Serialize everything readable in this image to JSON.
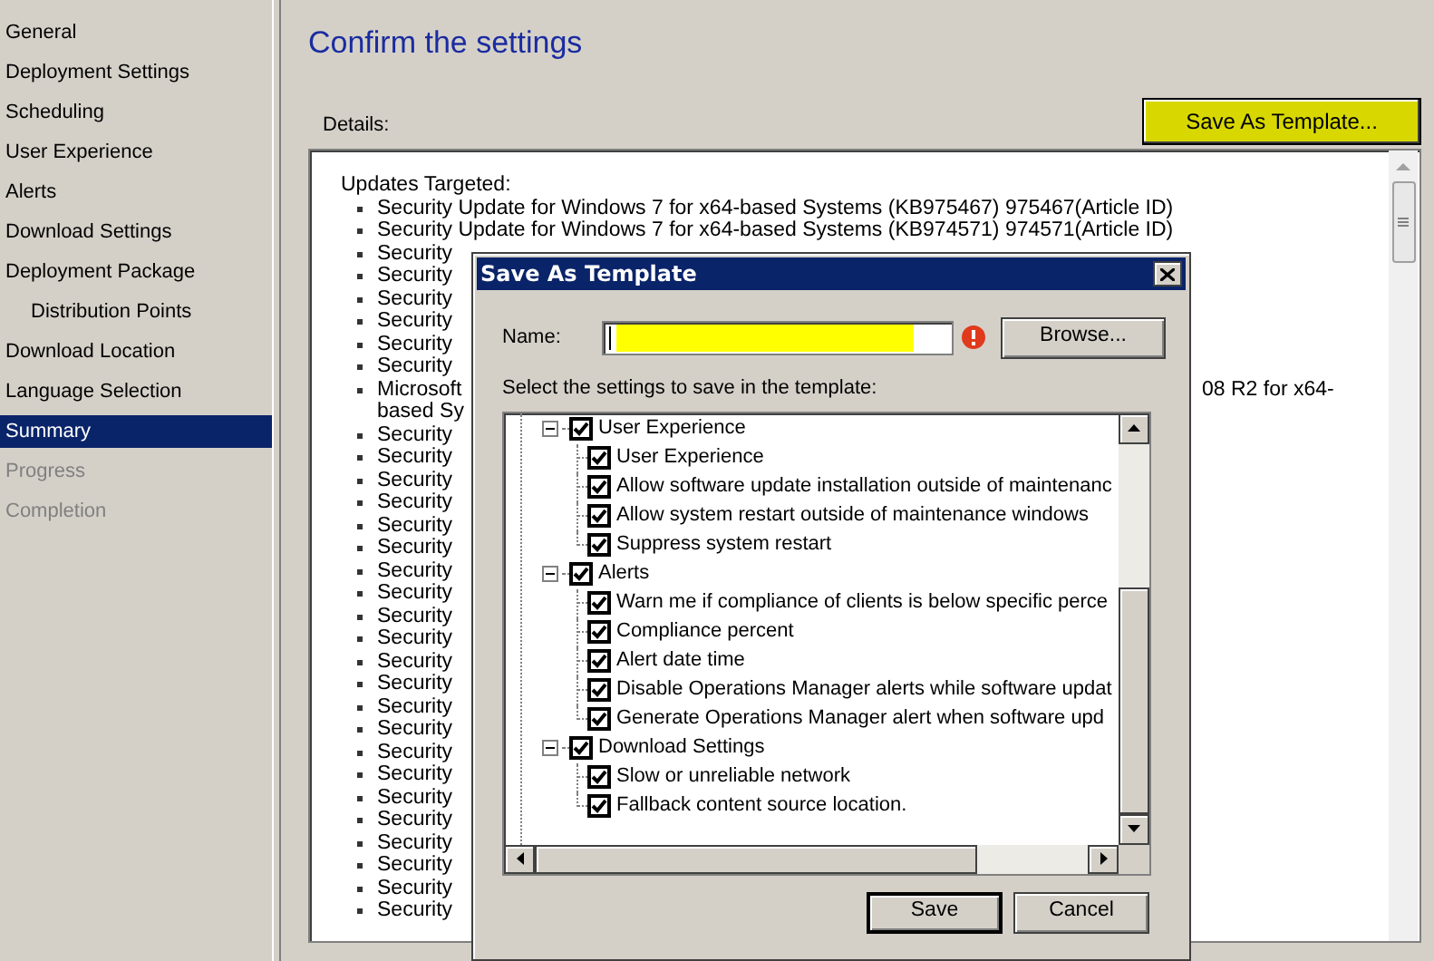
{
  "sidebar": {
    "items": [
      {
        "label": "General",
        "selected": false,
        "disabled": false
      },
      {
        "label": "Deployment Settings",
        "selected": false,
        "disabled": false
      },
      {
        "label": "Scheduling",
        "selected": false,
        "disabled": false
      },
      {
        "label": "User Experience",
        "selected": false,
        "disabled": false
      },
      {
        "label": "Alerts",
        "selected": false,
        "disabled": false
      },
      {
        "label": "Download Settings",
        "selected": false,
        "disabled": false
      },
      {
        "label": "Deployment Package",
        "selected": false,
        "disabled": false,
        "children": [
          {
            "label": "Distribution Points",
            "selected": false,
            "disabled": false
          }
        ]
      },
      {
        "label": "Download Location",
        "selected": false,
        "disabled": false
      },
      {
        "label": "Language Selection",
        "selected": false,
        "disabled": false
      },
      {
        "label": "Summary",
        "selected": true,
        "disabled": false
      },
      {
        "label": "Progress",
        "selected": false,
        "disabled": true
      },
      {
        "label": "Completion",
        "selected": false,
        "disabled": true
      }
    ]
  },
  "page": {
    "title": "Confirm the settings",
    "details_label": "Details:",
    "save_template_button": "Save As Template..."
  },
  "details": {
    "heading": "Updates Targeted:",
    "items": [
      {
        "kind": "line",
        "text": "Security Update for Windows 7 for x64-based Systems (KB975467) 975467(Article ID)"
      },
      {
        "kind": "line",
        "text": "Security Update for Windows 7 for x64-based Systems (KB974571) 974571(Article ID)"
      },
      {
        "kind": "line",
        "text": "Security"
      },
      {
        "kind": "line",
        "text": "Security"
      },
      {
        "kind": "line",
        "text": "Security"
      },
      {
        "kind": "line",
        "text": "Security"
      },
      {
        "kind": "line",
        "text": "Security"
      },
      {
        "kind": "line",
        "text": "Security"
      },
      {
        "kind": "split",
        "lines": [
          "Microsoft",
          "based Sy"
        ],
        "right": "08 R2 for x64-"
      },
      {
        "kind": "line",
        "text": "Security"
      },
      {
        "kind": "line",
        "text": "Security"
      },
      {
        "kind": "line",
        "text": "Security"
      },
      {
        "kind": "line",
        "text": "Security"
      },
      {
        "kind": "line",
        "text": "Security"
      },
      {
        "kind": "line",
        "text": "Security"
      },
      {
        "kind": "line",
        "text": "Security"
      },
      {
        "kind": "line",
        "text": "Security"
      },
      {
        "kind": "line",
        "text": "Security"
      },
      {
        "kind": "line",
        "text": "Security"
      },
      {
        "kind": "line",
        "text": "Security"
      },
      {
        "kind": "line",
        "text": "Security"
      },
      {
        "kind": "line",
        "text": "Security"
      },
      {
        "kind": "line",
        "text": "Security"
      },
      {
        "kind": "line",
        "text": "Security"
      },
      {
        "kind": "line",
        "text": "Security"
      },
      {
        "kind": "line",
        "text": "Security"
      },
      {
        "kind": "line",
        "text": "Security"
      },
      {
        "kind": "line",
        "text": "Security"
      },
      {
        "kind": "line",
        "text": "Security"
      },
      {
        "kind": "line",
        "text": "Security"
      },
      {
        "kind": "line",
        "text": "Security"
      }
    ]
  },
  "dialog": {
    "title": "Save As Template",
    "name_label": "Name:",
    "browse_button": "Browse...",
    "tree_label": "Select the settings to save in the template:",
    "tree": [
      {
        "label": "User Experience",
        "checked": true,
        "expanded": true,
        "children": [
          {
            "label": "User Experience",
            "checked": true
          },
          {
            "label": "Allow software update installation outside of maintenanc",
            "checked": true
          },
          {
            "label": "Allow system restart outside of maintenance windows",
            "checked": true
          },
          {
            "label": "Suppress system restart",
            "checked": true
          }
        ]
      },
      {
        "label": "Alerts",
        "checked": true,
        "expanded": true,
        "children": [
          {
            "label": "Warn me if compliance of clients is below specific perce",
            "checked": true
          },
          {
            "label": "Compliance percent",
            "checked": true
          },
          {
            "label": "Alert date time",
            "checked": true
          },
          {
            "label": "Disable Operations Manager alerts while software updat",
            "checked": true
          },
          {
            "label": "Generate Operations Manager alert when software upd",
            "checked": true
          }
        ]
      },
      {
        "label": "Download Settings",
        "checked": true,
        "expanded": true,
        "children": [
          {
            "label": "Slow or unreliable network",
            "checked": true
          },
          {
            "label": "Fallback content source location.",
            "checked": true
          }
        ]
      }
    ],
    "buttons": [
      {
        "label": "Save",
        "default": true
      },
      {
        "label": "Cancel",
        "default": false
      }
    ]
  }
}
